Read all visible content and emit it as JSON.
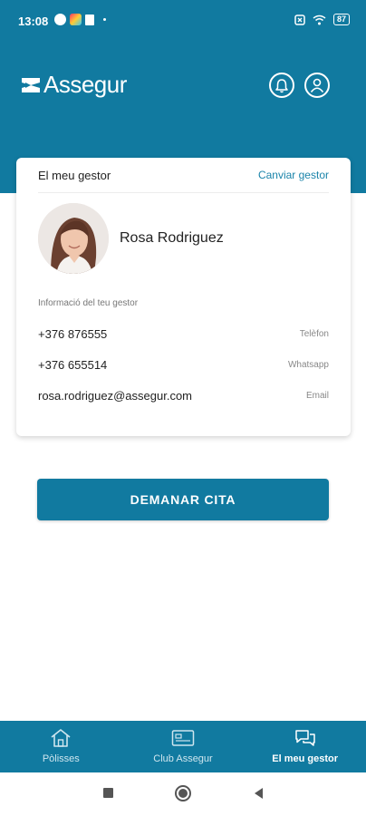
{
  "status_bar": {
    "time": "13:08",
    "battery": "87"
  },
  "header": {
    "brand": "Assegur",
    "notifications_icon": "bell-icon",
    "profile_icon": "user-icon"
  },
  "card": {
    "title": "El meu gestor",
    "action_label": "Canviar gestor",
    "gestor_name": "Rosa Rodriguez",
    "info_label": "Informació del teu gestor",
    "contacts": [
      {
        "value": "+376 876555",
        "kind": "Telèfon"
      },
      {
        "value": "+376 655514",
        "kind": "Whatsapp"
      },
      {
        "value": "rosa.rodriguez@assegur.com",
        "kind": "Email"
      }
    ]
  },
  "cta": {
    "label": "DEMANAR CITA"
  },
  "bottom_nav": {
    "items": [
      {
        "label": "Pòlisses",
        "icon": "house-icon"
      },
      {
        "label": "Club Assegur",
        "icon": "card-icon"
      },
      {
        "label": "El meu gestor",
        "icon": "chat-icon",
        "active": true
      }
    ]
  },
  "colors": {
    "primary": "#117aa0",
    "link": "#1b84aa"
  }
}
